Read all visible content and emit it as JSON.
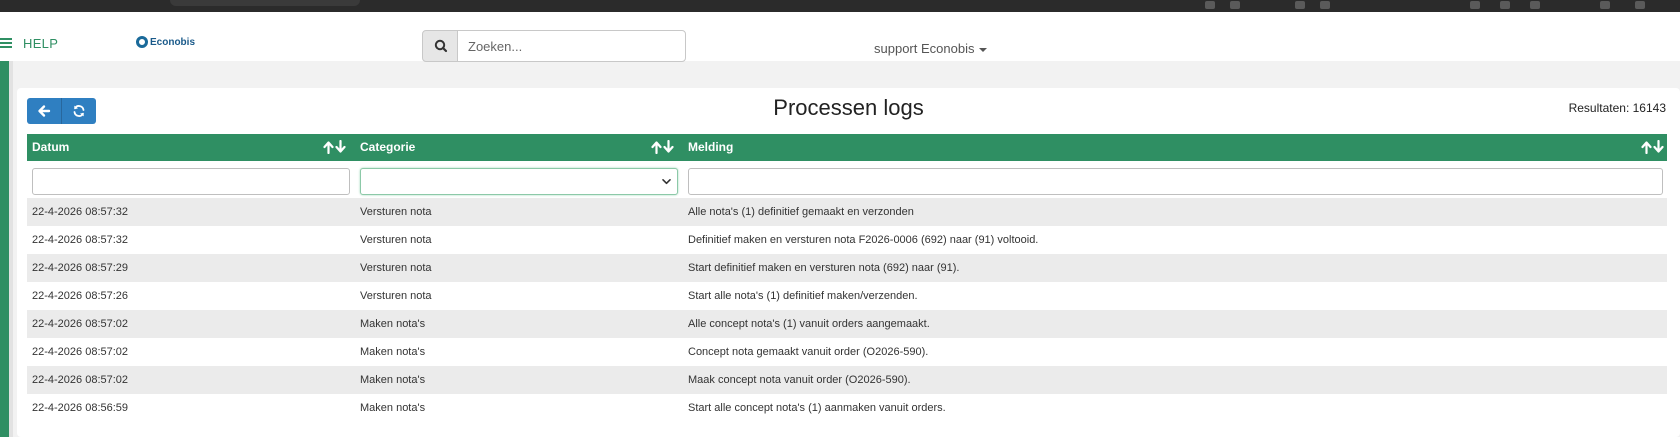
{
  "topnav": {
    "help_label": "HELP",
    "logo_text": "Econobis",
    "search_placeholder": "Zoeken...",
    "user_label": "support Econobis"
  },
  "colors": {
    "brand_green": "#2f8f63",
    "primary_blue": "#2f7fc1",
    "row_stripe": "#ebebeb"
  },
  "icons": {
    "menu": "hamburger-menu-icon",
    "search": "search-icon",
    "back": "arrow-left-icon",
    "refresh": "refresh-icon",
    "sort": "sort-up-down-icon"
  },
  "page": {
    "title": "Processen logs",
    "results_label": "Resultaten: 16143"
  },
  "table": {
    "columns": [
      "Datum",
      "Categorie",
      "Melding"
    ],
    "rows": [
      [
        "22-4-2026 08:57:32",
        "Versturen nota",
        "Alle nota's (1) definitief gemaakt en verzonden"
      ],
      [
        "22-4-2026 08:57:32",
        "Versturen nota",
        "Definitief maken en versturen nota F2026-0006 (692) naar (91) voltooid."
      ],
      [
        "22-4-2026 08:57:29",
        "Versturen nota",
        "Start definitief maken en versturen nota (692) naar (91)."
      ],
      [
        "22-4-2026 08:57:26",
        "Versturen nota",
        "Start alle nota's (1) definitief maken/verzenden."
      ],
      [
        "22-4-2026 08:57:02",
        "Maken nota's",
        "Alle concept nota's (1) vanuit orders aangemaakt."
      ],
      [
        "22-4-2026 08:57:02",
        "Maken nota's",
        "Concept nota gemaakt vanuit order (O2026-590)."
      ],
      [
        "22-4-2026 08:57:02",
        "Maken nota's",
        "Maak concept nota vanuit order (O2026-590)."
      ],
      [
        "22-4-2026 08:56:59",
        "Maken nota's",
        "Start alle concept nota's (1) aanmaken vanuit orders."
      ]
    ]
  }
}
